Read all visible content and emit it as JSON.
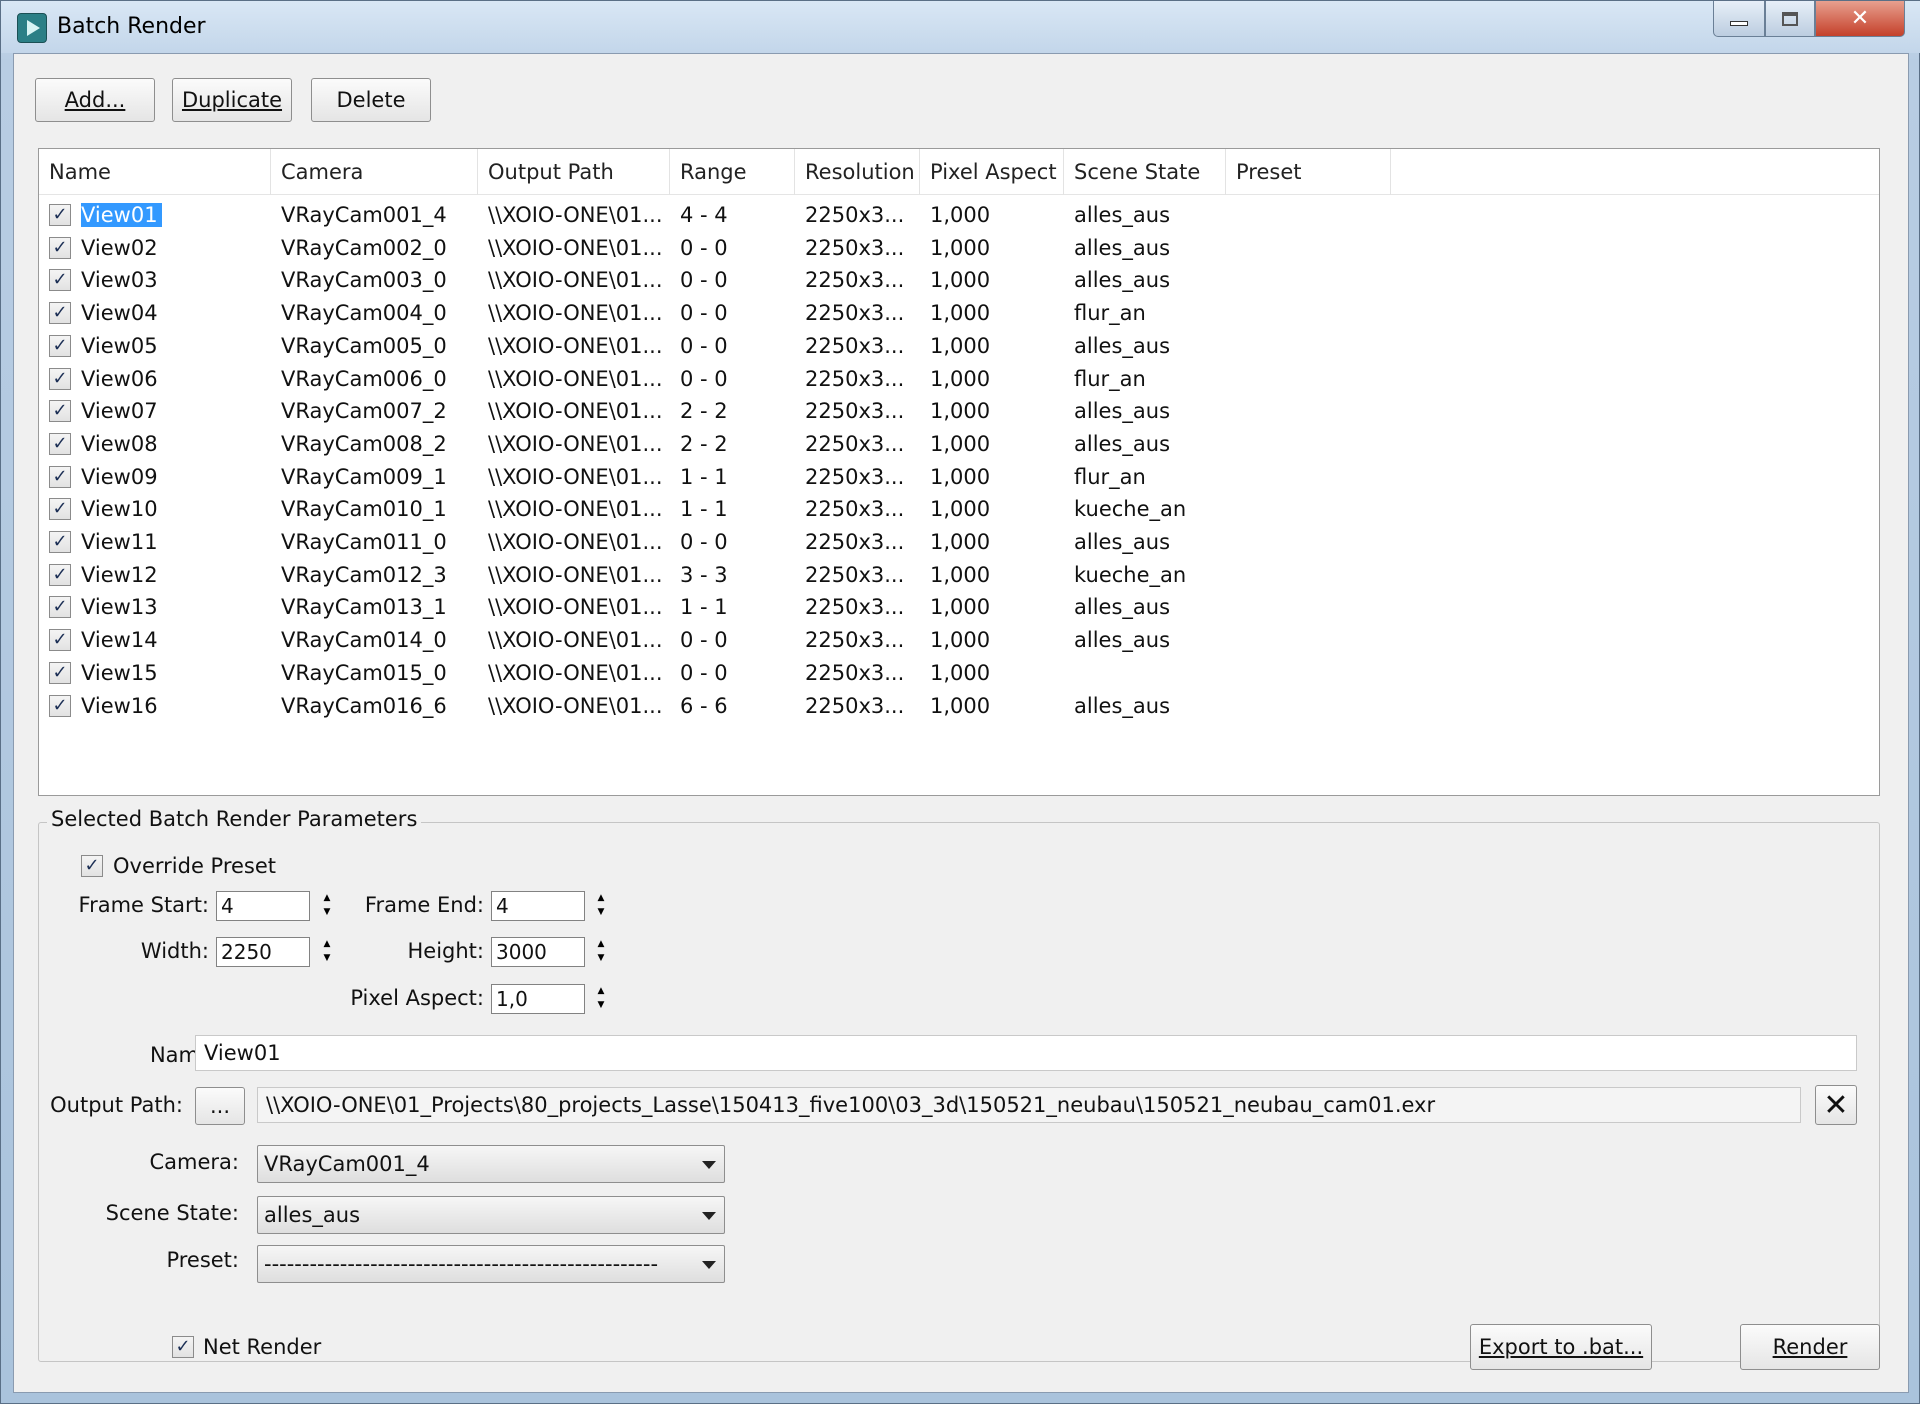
{
  "window": {
    "title": "Batch Render",
    "minimize_icon": "minimize-icon",
    "maximize_icon": "maximize-icon",
    "close_icon": "close-icon"
  },
  "toolbar": {
    "add_label": "Add...",
    "duplicate_label": "Duplicate",
    "delete_label": "Delete"
  },
  "list": {
    "columns": [
      "Name",
      "Camera",
      "Output Path",
      "Range",
      "Resolution",
      "Pixel Aspect",
      "Scene State",
      "Preset"
    ],
    "rows": [
      {
        "checked": true,
        "name": "View01",
        "camera": "VRayCam001_4",
        "output_path": "\\\\XOIO-ONE\\01...",
        "range": "4 - 4",
        "resolution": "2250x3...",
        "pixel_aspect": "1,000",
        "scene_state": "alles_aus",
        "preset": "",
        "selected": true
      },
      {
        "checked": true,
        "name": "View02",
        "camera": "VRayCam002_0",
        "output_path": "\\\\XOIO-ONE\\01...",
        "range": "0 - 0",
        "resolution": "2250x3...",
        "pixel_aspect": "1,000",
        "scene_state": "alles_aus",
        "preset": ""
      },
      {
        "checked": true,
        "name": "View03",
        "camera": "VRayCam003_0",
        "output_path": "\\\\XOIO-ONE\\01...",
        "range": "0 - 0",
        "resolution": "2250x3...",
        "pixel_aspect": "1,000",
        "scene_state": "alles_aus",
        "preset": ""
      },
      {
        "checked": true,
        "name": "View04",
        "camera": "VRayCam004_0",
        "output_path": "\\\\XOIO-ONE\\01...",
        "range": "0 - 0",
        "resolution": "2250x3...",
        "pixel_aspect": "1,000",
        "scene_state": "flur_an",
        "preset": ""
      },
      {
        "checked": true,
        "name": "View05",
        "camera": "VRayCam005_0",
        "output_path": "\\\\XOIO-ONE\\01...",
        "range": "0 - 0",
        "resolution": "2250x3...",
        "pixel_aspect": "1,000",
        "scene_state": "alles_aus",
        "preset": ""
      },
      {
        "checked": true,
        "name": "View06",
        "camera": "VRayCam006_0",
        "output_path": "\\\\XOIO-ONE\\01...",
        "range": "0 - 0",
        "resolution": "2250x3...",
        "pixel_aspect": "1,000",
        "scene_state": "flur_an",
        "preset": ""
      },
      {
        "checked": true,
        "name": "View07",
        "camera": "VRayCam007_2",
        "output_path": "\\\\XOIO-ONE\\01...",
        "range": "2 - 2",
        "resolution": "2250x3...",
        "pixel_aspect": "1,000",
        "scene_state": "alles_aus",
        "preset": ""
      },
      {
        "checked": true,
        "name": "View08",
        "camera": "VRayCam008_2",
        "output_path": "\\\\XOIO-ONE\\01...",
        "range": "2 - 2",
        "resolution": "2250x3...",
        "pixel_aspect": "1,000",
        "scene_state": "alles_aus",
        "preset": ""
      },
      {
        "checked": true,
        "name": "View09",
        "camera": "VRayCam009_1",
        "output_path": "\\\\XOIO-ONE\\01...",
        "range": "1 - 1",
        "resolution": "2250x3...",
        "pixel_aspect": "1,000",
        "scene_state": "flur_an",
        "preset": ""
      },
      {
        "checked": true,
        "name": "View10",
        "camera": "VRayCam010_1",
        "output_path": "\\\\XOIO-ONE\\01...",
        "range": "1 - 1",
        "resolution": "2250x3...",
        "pixel_aspect": "1,000",
        "scene_state": "kueche_an",
        "preset": ""
      },
      {
        "checked": true,
        "name": "View11",
        "camera": "VRayCam011_0",
        "output_path": "\\\\XOIO-ONE\\01...",
        "range": "0 - 0",
        "resolution": "2250x3...",
        "pixel_aspect": "1,000",
        "scene_state": "alles_aus",
        "preset": ""
      },
      {
        "checked": true,
        "name": "View12",
        "camera": "VRayCam012_3",
        "output_path": "\\\\XOIO-ONE\\01...",
        "range": "3 - 3",
        "resolution": "2250x3...",
        "pixel_aspect": "1,000",
        "scene_state": "kueche_an",
        "preset": ""
      },
      {
        "checked": true,
        "name": "View13",
        "camera": "VRayCam013_1",
        "output_path": "\\\\XOIO-ONE\\01...",
        "range": "1 - 1",
        "resolution": "2250x3...",
        "pixel_aspect": "1,000",
        "scene_state": "alles_aus",
        "preset": ""
      },
      {
        "checked": true,
        "name": "View14",
        "camera": "VRayCam014_0",
        "output_path": "\\\\XOIO-ONE\\01...",
        "range": "0 - 0",
        "resolution": "2250x3...",
        "pixel_aspect": "1,000",
        "scene_state": "alles_aus",
        "preset": ""
      },
      {
        "checked": true,
        "name": "View15",
        "camera": "VRayCam015_0",
        "output_path": "\\\\XOIO-ONE\\01...",
        "range": "0 - 0",
        "resolution": "2250x3...",
        "pixel_aspect": "1,000",
        "scene_state": "",
        "preset": ""
      },
      {
        "checked": true,
        "name": "View16",
        "camera": "VRayCam016_6",
        "output_path": "\\\\XOIO-ONE\\01...",
        "range": "6 - 6",
        "resolution": "2250x3...",
        "pixel_aspect": "1,000",
        "scene_state": "alles_aus",
        "preset": ""
      }
    ]
  },
  "params": {
    "group_title": "Selected Batch Render Parameters",
    "override_preset_label": "Override Preset",
    "override_preset_checked": true,
    "frame_start_label": "Frame Start:",
    "frame_start_value": "4",
    "frame_end_label": "Frame End:",
    "frame_end_value": "4",
    "width_label": "Width:",
    "width_value": "2250",
    "height_label": "Height:",
    "height_value": "3000",
    "pixel_aspect_label": "Pixel Aspect:",
    "pixel_aspect_value": "1,0",
    "name_label": "Name:",
    "name_value": "View01",
    "output_path_label": "Output Path:",
    "browse_label": "...",
    "output_path_value": "\\\\XOIO-ONE\\01_Projects\\80_projects_Lasse\\150413_five100\\03_3d\\150521_neubau\\150521_neubau_cam01.exr",
    "clear_path_icon": "clear-x-icon",
    "camera_label": "Camera:",
    "camera_value": "VRayCam001_4",
    "scene_state_label": "Scene State:",
    "scene_state_value": "alles_aus",
    "preset_label": "Preset:",
    "preset_value": "----------------------------------------------------"
  },
  "footer": {
    "net_render_label": "Net Render",
    "net_render_checked": true,
    "export_label": "Export to .bat...",
    "render_label": "Render"
  },
  "colors": {
    "selection": "#3399ff",
    "dialog_bg": "#f0f0f0",
    "close_button": "#c4402a"
  }
}
